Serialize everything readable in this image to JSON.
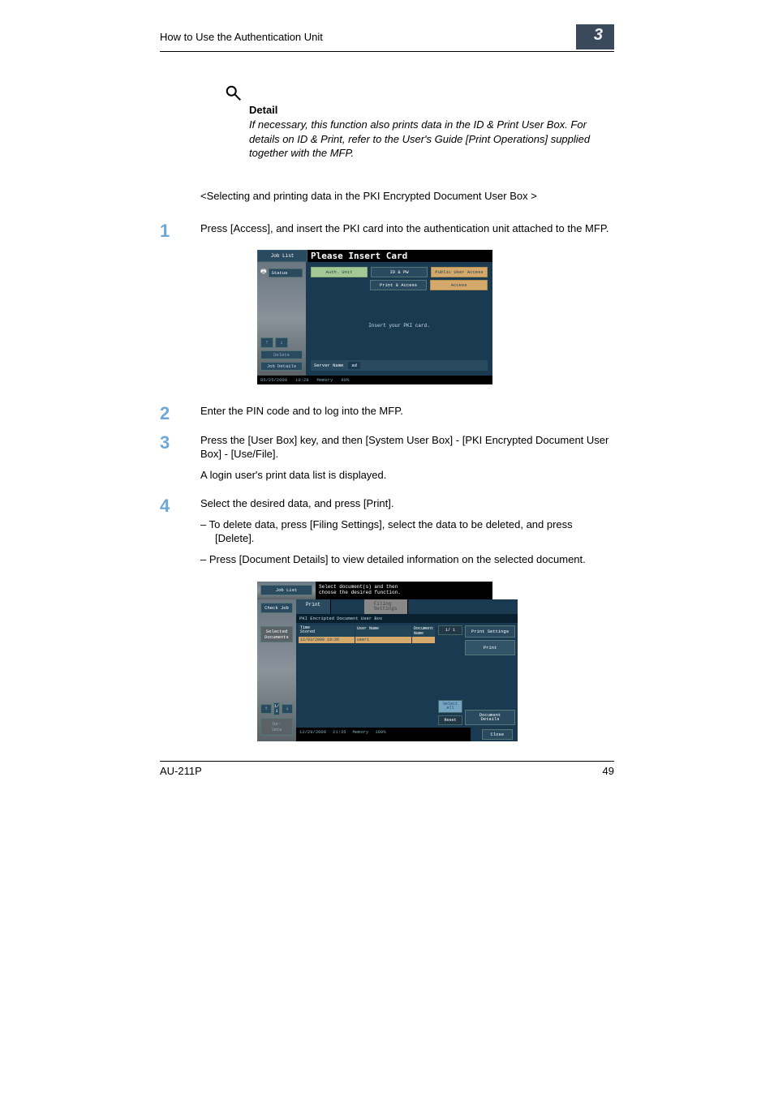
{
  "header": {
    "title": "How to Use the Authentication Unit",
    "chapter": "3"
  },
  "detail": {
    "label": "Detail",
    "text": "If necessary, this function also prints data in the ID & Print User Box. For details on ID & Print, refer to the User's Guide [Print Operations] supplied together with the MFP."
  },
  "section_mid": "<Selecting and printing data in the PKI Encrypted Document User Box >",
  "steps": [
    {
      "num": "1",
      "paras": [
        "Press [Access], and insert the PKI card into the authentication unit attached to the MFP."
      ]
    },
    {
      "num": "2",
      "paras": [
        "Enter the PIN code and to log into the MFP."
      ]
    },
    {
      "num": "3",
      "paras": [
        "Press the [User Box] key, and then [System User Box] - [PKI Encrypted Document User Box] - [Use/File].",
        "A login user's print data list is displayed."
      ]
    },
    {
      "num": "4",
      "paras": [
        "Select the desired data, and press [Print]."
      ],
      "subs": [
        "–   To delete data, press [Filing Settings], select the data to be deleted, and press [Delete].",
        "–   Press [Document Details] to view detailed information on the selected document."
      ]
    }
  ],
  "ss1": {
    "job_list": "Job List",
    "title": "Please Insert Card",
    "status": "Status",
    "tabs": {
      "auth": "Auth. Unit",
      "idpw": "ID & PW",
      "public": "Public User Access"
    },
    "row2": {
      "print_access": "Print & Access",
      "access": "Access"
    },
    "center": "Insert your PKI card.",
    "delete": "Delete",
    "job_details": "Job Details",
    "server_label": "Server Name",
    "server_value": "ad",
    "footer_date": "05/25/2009",
    "footer_time": "10:28",
    "footer_mem": "Memory",
    "footer_mem_v": "90%"
  },
  "ss2": {
    "job_list": "Job List",
    "check_job": "Check Job",
    "sel_docs": "Selected Documents",
    "title": "Select document(s) and then\nchoose the desired function.",
    "tab_print": "Print",
    "tab_filing": "Filing\nSettings",
    "header": "PKI Encripted Document User Box",
    "col_time": "Time\nStored",
    "col_user": "User Name",
    "col_doc": "Document Name",
    "row_time": "12/03/2008 19:26",
    "row_user": "user1",
    "page_ind": "1/  1",
    "select_all": "Select\nAll",
    "reset": "Reset",
    "print_settings": "Print Settings",
    "print": "Print",
    "doc_details": "Document\nDetails",
    "close": "Close",
    "nav_page": "1/  1",
    "footer_date": "12/29/2009",
    "footer_time": "21:35",
    "footer_mem": "Memory",
    "footer_mem_v": "100%"
  },
  "footer": {
    "model": "AU-211P",
    "page": "49"
  }
}
